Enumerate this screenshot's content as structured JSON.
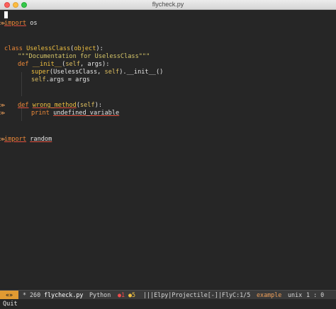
{
  "window": {
    "title": "flycheck.py"
  },
  "editor": {
    "fringe_marker": "≫",
    "lines": {
      "l1": {
        "kw": "import",
        "rest": " os"
      },
      "l4": {
        "kw": "class",
        "sp": " ",
        "name": "UselessClass",
        "open": "(",
        "base": "object",
        "close": "):"
      },
      "l5": {
        "doc": "\"\"\"Documentation for UselessClass\"\"\""
      },
      "l6": {
        "kw": "def",
        "sp": " ",
        "name": "__init__",
        "open": "(",
        "self": "self",
        "rest": ", args):"
      },
      "l7": {
        "fn": "super",
        "open": "(",
        "cls": "UselessClass",
        "sep": ", ",
        "self": "self",
        "rest": ").__init__()"
      },
      "l8": {
        "self": "self",
        "rest": ".args = args"
      },
      "l11": {
        "kw": "def",
        "sp": " ",
        "name": "wrong_method",
        "open": "(",
        "self": "self",
        "close": "):"
      },
      "l12": {
        "kw": "print",
        "sp": " ",
        "rest": "undefined_variable"
      },
      "l15": {
        "kw": "import",
        "sp": " ",
        "rest": "random"
      }
    }
  },
  "modeline": {
    "arrows": "«»",
    "modified": "*",
    "size": "260",
    "buffer": "flycheck.py",
    "mode": "Python",
    "errors": "●1",
    "warnings": "●5",
    "minor": "|||Elpy|Projectile[-]|FlyC:1/5",
    "perspective": "example",
    "encoding": "unix",
    "position": "1 : 0"
  },
  "minibuffer": {
    "text": "Quit"
  },
  "colors": {
    "keyword": "#f08a38",
    "string": "#d8c86a",
    "function": "#f0c040",
    "error_underline": "#e4503e",
    "modeline_bg": "#3a3a3a",
    "background": "#262626"
  }
}
